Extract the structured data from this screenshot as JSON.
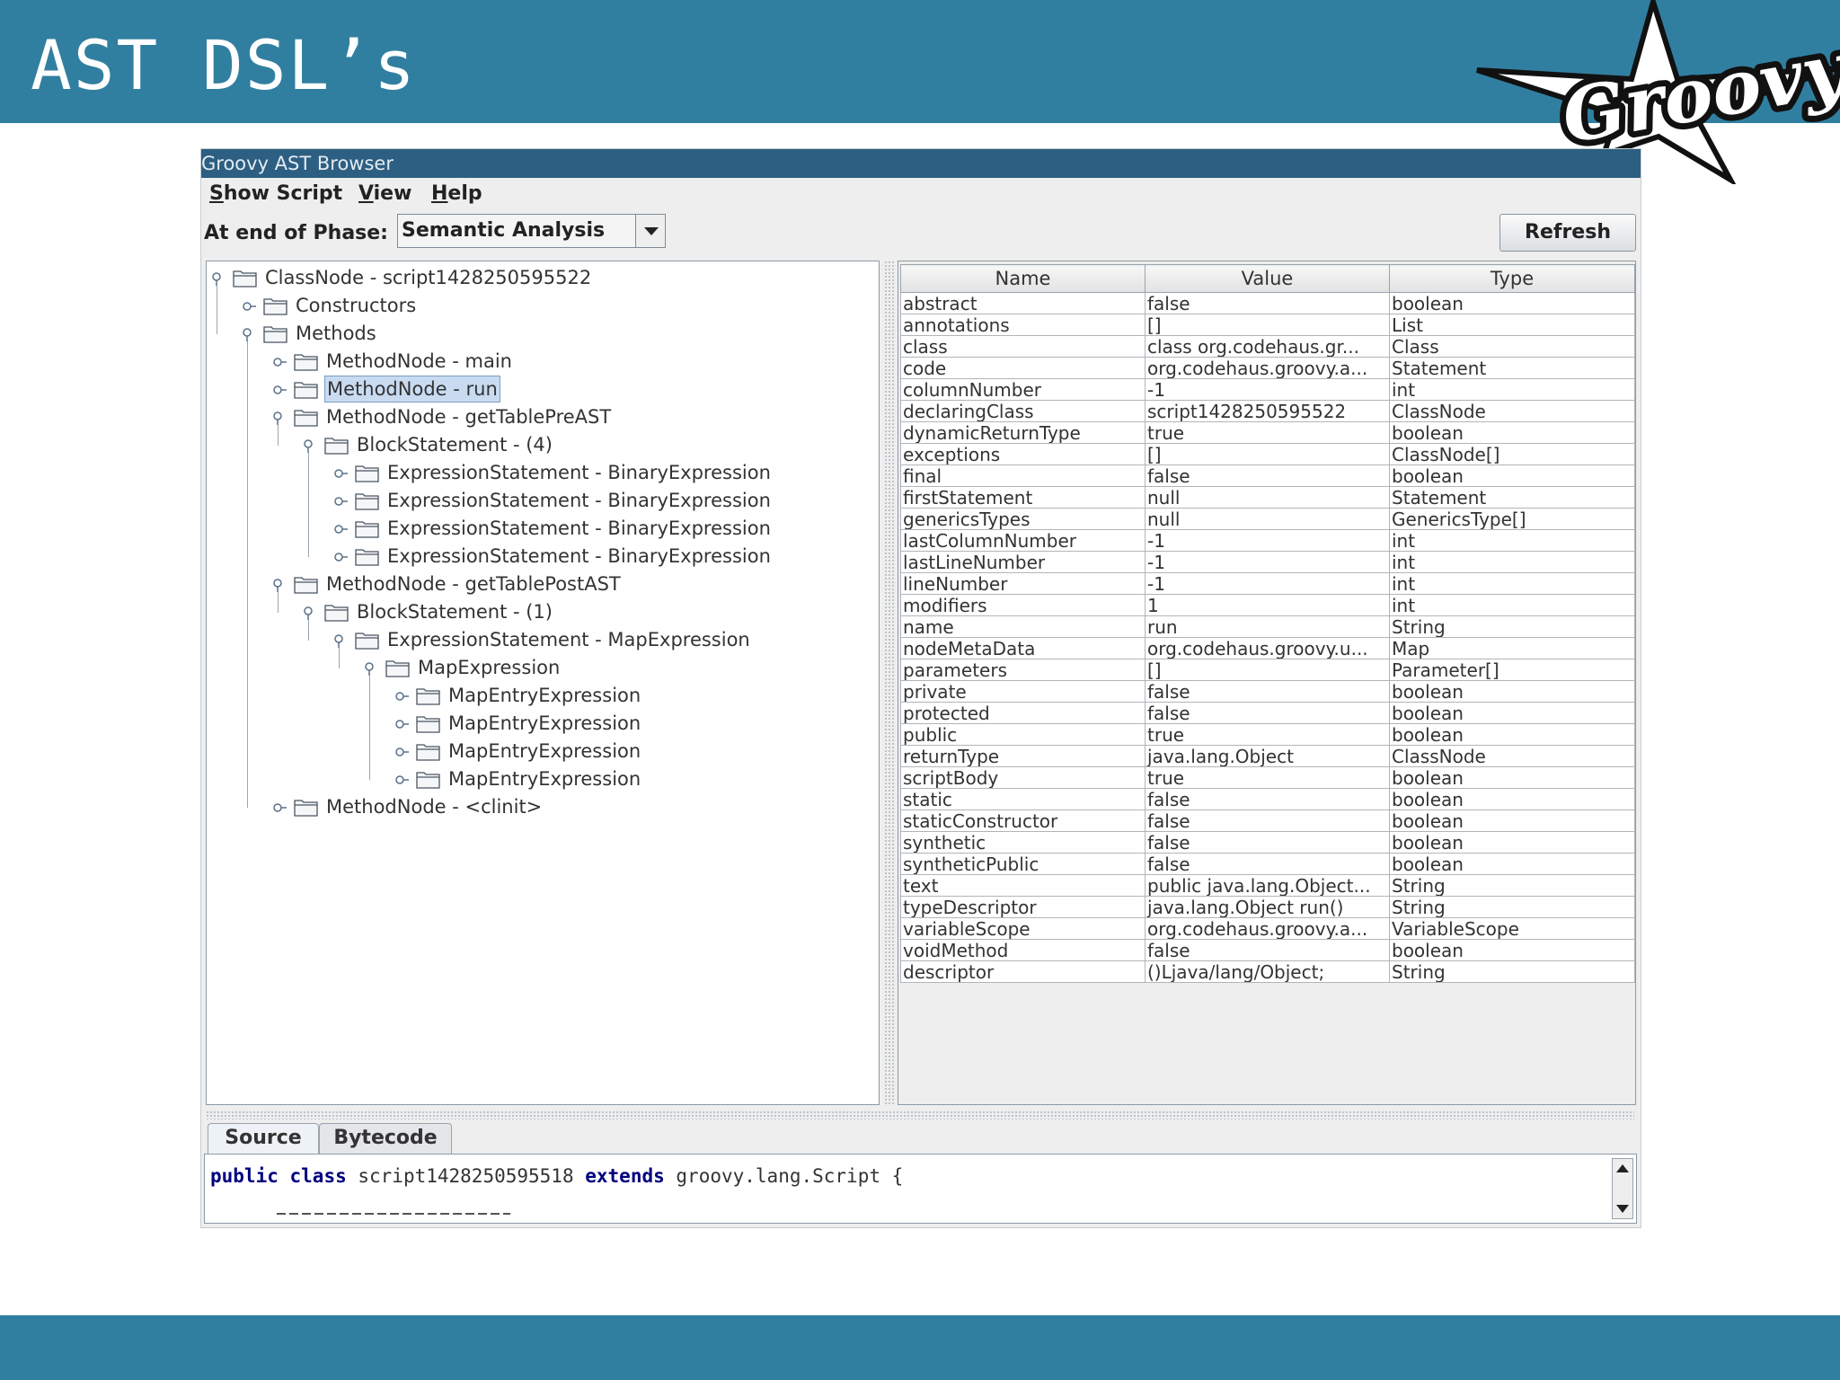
{
  "slide": {
    "title": "AST DSL’s",
    "logo_text": "Groovy",
    "colors": {
      "header": "#317fa0",
      "footer": "#317fa0"
    }
  },
  "window": {
    "title": "Groovy AST Browser",
    "menu": [
      {
        "mnemonic": "S",
        "rest": "how Script"
      },
      {
        "mnemonic": "V",
        "rest": "iew"
      },
      {
        "mnemonic": "H",
        "rest": "elp"
      }
    ],
    "phase_label": "At end of Phase:",
    "phase_value": "Semantic Analysis",
    "refresh_label": "Refresh"
  },
  "tree": {
    "nodes": [
      {
        "label": "ClassNode - script1428250595522",
        "expanded": true
      },
      {
        "label": "Constructors",
        "expanded": false
      },
      {
        "label": "Methods",
        "expanded": true
      },
      {
        "label": "MethodNode - main",
        "expanded": false
      },
      {
        "label": "MethodNode - run",
        "expanded": false,
        "selected": true
      },
      {
        "label": "MethodNode - getTablePreAST",
        "expanded": true
      },
      {
        "label": "BlockStatement - (4)",
        "expanded": true
      },
      {
        "label": "ExpressionStatement - BinaryExpression",
        "expanded": false
      },
      {
        "label": "ExpressionStatement - BinaryExpression",
        "expanded": false
      },
      {
        "label": "ExpressionStatement - BinaryExpression",
        "expanded": false
      },
      {
        "label": "ExpressionStatement - BinaryExpression",
        "expanded": false
      },
      {
        "label": "MethodNode - getTablePostAST",
        "expanded": true
      },
      {
        "label": "BlockStatement - (1)",
        "expanded": true
      },
      {
        "label": "ExpressionStatement - MapExpression",
        "expanded": true
      },
      {
        "label": "MapExpression",
        "expanded": true
      },
      {
        "label": "MapEntryExpression",
        "expanded": false
      },
      {
        "label": "MapEntryExpression",
        "expanded": false
      },
      {
        "label": "MapEntryExpression",
        "expanded": false
      },
      {
        "label": "MapEntryExpression",
        "expanded": false
      },
      {
        "label": "MethodNode - <clinit>",
        "expanded": false
      }
    ]
  },
  "properties": {
    "columns": [
      "Name",
      "Value",
      "Type"
    ],
    "rows": [
      [
        "abstract",
        "false",
        "boolean"
      ],
      [
        "annotations",
        "[]",
        "List"
      ],
      [
        "class",
        "class org.codehaus.gr...",
        "Class"
      ],
      [
        "code",
        "org.codehaus.groovy.a...",
        "Statement"
      ],
      [
        "columnNumber",
        "-1",
        "int"
      ],
      [
        "declaringClass",
        "script1428250595522",
        "ClassNode"
      ],
      [
        "dynamicReturnType",
        "true",
        "boolean"
      ],
      [
        "exceptions",
        "[]",
        "ClassNode[]"
      ],
      [
        "final",
        "false",
        "boolean"
      ],
      [
        "firstStatement",
        "null",
        "Statement"
      ],
      [
        "genericsTypes",
        "null",
        "GenericsType[]"
      ],
      [
        "lastColumnNumber",
        "-1",
        "int"
      ],
      [
        "lastLineNumber",
        "-1",
        "int"
      ],
      [
        "lineNumber",
        "-1",
        "int"
      ],
      [
        "modifiers",
        "1",
        "int"
      ],
      [
        "name",
        "run",
        "String"
      ],
      [
        "nodeMetaData",
        "org.codehaus.groovy.u...",
        "Map"
      ],
      [
        "parameters",
        "[]",
        "Parameter[]"
      ],
      [
        "private",
        "false",
        "boolean"
      ],
      [
        "protected",
        "false",
        "boolean"
      ],
      [
        "public",
        "true",
        "boolean"
      ],
      [
        "returnType",
        "java.lang.Object",
        "ClassNode"
      ],
      [
        "scriptBody",
        "true",
        "boolean"
      ],
      [
        "static",
        "false",
        "boolean"
      ],
      [
        "staticConstructor",
        "false",
        "boolean"
      ],
      [
        "synthetic",
        "false",
        "boolean"
      ],
      [
        "syntheticPublic",
        "false",
        "boolean"
      ],
      [
        "text",
        "public java.lang.Object...",
        "String"
      ],
      [
        "typeDescriptor",
        "java.lang.Object run()",
        "String"
      ],
      [
        "variableScope",
        "org.codehaus.groovy.a...",
        "VariableScope"
      ],
      [
        "voidMethod",
        "false",
        "boolean"
      ],
      [
        "descriptor",
        "()Ljava/lang/Object;",
        "String"
      ]
    ]
  },
  "bottom": {
    "tabs": [
      "Source",
      "Bytecode"
    ],
    "active_tab": "Source",
    "source_tokens": [
      {
        "text": "public",
        "kw": true
      },
      {
        "text": " ",
        "kw": false
      },
      {
        "text": "class",
        "kw": true
      },
      {
        "text": " script1428250595518 ",
        "kw": false
      },
      {
        "text": "extends",
        "kw": true
      },
      {
        "text": " groovy.lang.Script {",
        "kw": false
      }
    ]
  }
}
